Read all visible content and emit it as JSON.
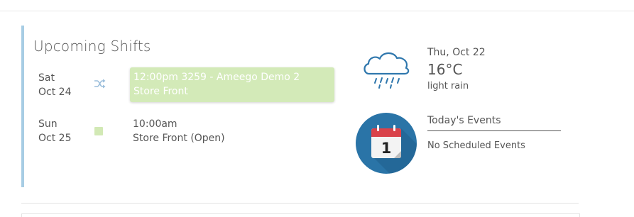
{
  "upcoming": {
    "title": "Upcoming Shifts",
    "shifts": [
      {
        "day": "Sat",
        "date": "Oct 24",
        "icon": "shuffle-icon",
        "line1": "12:00pm 3259 - Ameego Demo 2",
        "line2": "Store Front",
        "highlight_color": "#d3eab8"
      },
      {
        "day": "Sun",
        "date": "Oct 25",
        "icon": "status-square",
        "line1": "10:00am",
        "line2": "Store Front (Open)"
      }
    ]
  },
  "weather": {
    "date": "Thu, Oct 22",
    "temperature": "16°C",
    "condition": "light rain",
    "icon": "rain-cloud-icon"
  },
  "events": {
    "title": "Today's Events",
    "empty_text": "No Scheduled Events",
    "icon": "calendar-icon",
    "calendar_day": "1"
  },
  "colors": {
    "accent_bar": "#a7cde4",
    "shift_highlight": "#d3eab8",
    "calendar_circle": "#2a74a7",
    "calendar_red": "#d9424a"
  }
}
